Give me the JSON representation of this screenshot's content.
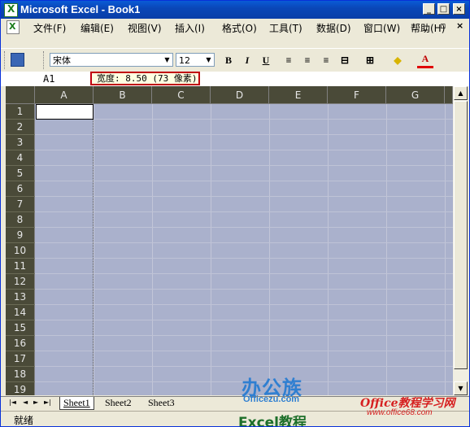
{
  "window": {
    "title": "Microsoft Excel - Book1",
    "controls": {
      "minimize": "_",
      "maximize": "□",
      "close": "×"
    }
  },
  "menu": {
    "items": [
      "文件(F)",
      "编辑(E)",
      "视图(V)",
      "插入(I)",
      "格式(O)",
      "工具(T)",
      "数据(D)",
      "窗口(W)",
      "帮助(H)"
    ],
    "doc_controls": {
      "close": "×",
      "restore": "▫",
      "minimize": "_"
    }
  },
  "toolbar": {
    "font_name": "宋体",
    "font_size": "12",
    "bold": "B",
    "italic": "I",
    "underline": "U",
    "font_color_label": "A"
  },
  "formula_bar": {
    "name_box": "A1",
    "width_tooltip": "宽度: 8.50 (73 像素)"
  },
  "grid": {
    "columns": [
      "A",
      "B",
      "C",
      "D",
      "E",
      "F",
      "G"
    ],
    "rows": [
      "1",
      "2",
      "3",
      "4",
      "5",
      "6",
      "7",
      "8",
      "9",
      "10",
      "11",
      "12",
      "13",
      "14",
      "15",
      "16",
      "17",
      "18",
      "19"
    ]
  },
  "sheets": {
    "tabs": [
      "Sheet1",
      "Sheet2",
      "Sheet3"
    ],
    "active": "Sheet1",
    "nav": [
      "|◄",
      "◄",
      "►",
      "►|"
    ]
  },
  "status": {
    "text": "就绪"
  },
  "colors": {
    "title_bar": "#0a47b8",
    "header_bg": "#4a4a38",
    "grid_selection": "#aab1cc",
    "tooltip_border": "#c0000f"
  },
  "watermarks": {
    "logo": "办公族",
    "logo_sub": "Officezu.com",
    "excel_tag": "Excel教程",
    "site": "Office教程学习网",
    "url": "www.office68.com"
  }
}
